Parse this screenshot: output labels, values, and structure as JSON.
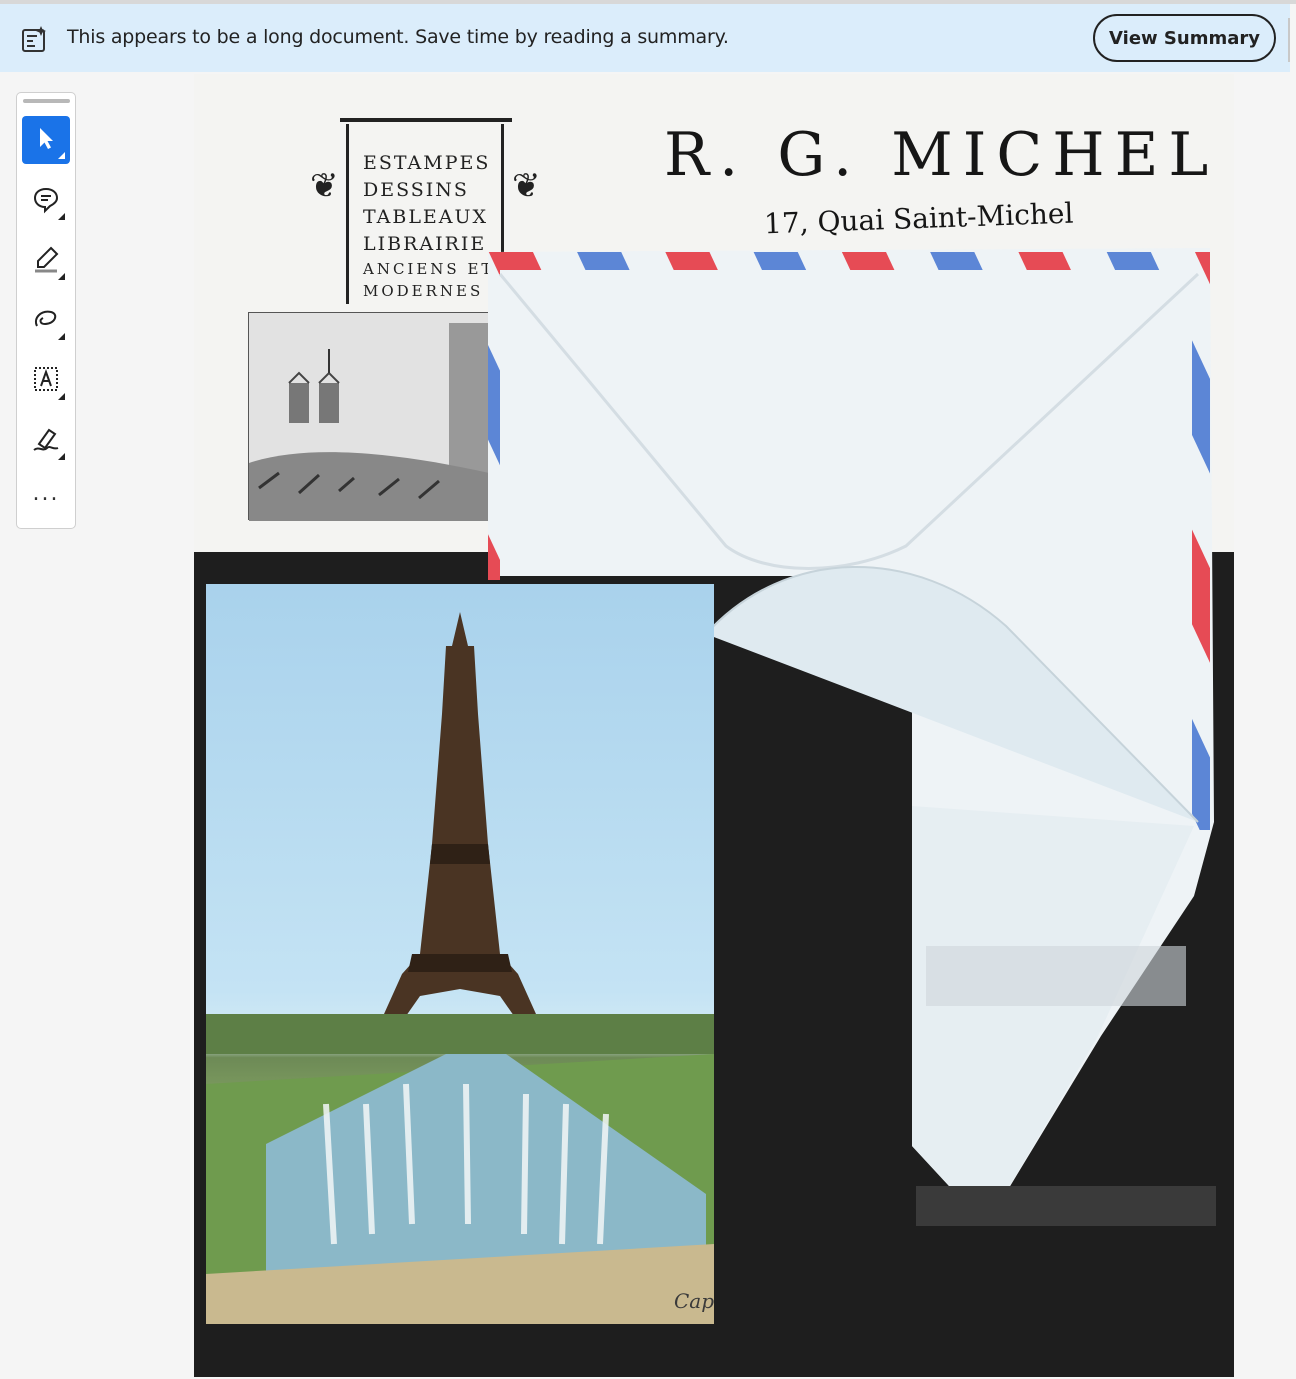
{
  "banner": {
    "icon": "summary-doc-icon",
    "message": "This appears to be a long document. Save time by reading a summary.",
    "button_label": "View Summary"
  },
  "toolbar": {
    "tools": [
      {
        "name": "select",
        "icon": "pointer-arrow-icon",
        "active": true
      },
      {
        "name": "comment",
        "icon": "comment-bubble-icon",
        "active": false
      },
      {
        "name": "highlight",
        "icon": "highlighter-pen-icon",
        "active": false
      },
      {
        "name": "draw",
        "icon": "freehand-loop-icon",
        "active": false
      },
      {
        "name": "text-box",
        "icon": "text-box-icon",
        "active": false
      },
      {
        "name": "sign",
        "icon": "signature-pen-icon",
        "active": false
      },
      {
        "name": "more",
        "icon": "more-dots-icon",
        "active": false
      }
    ],
    "more_label": "..."
  },
  "document": {
    "letterhead": {
      "lines": [
        "ESTAMPES",
        "DESSINS",
        "TABLEAUX",
        "LIBRAIRIE",
        "ANCIENS ET",
        "MODERNES"
      ],
      "name": "R. G. MICHEL",
      "address": "17, Quai Saint-Michel"
    },
    "postcard": {
      "publisher_mark": "Cap"
    },
    "colors": {
      "airmail_red": "#e64b55",
      "airmail_blue": "#5c86d6",
      "page_bg": "#1e1e1e",
      "accent": "#1a73e8",
      "banner_bg": "#dbedfb"
    }
  }
}
